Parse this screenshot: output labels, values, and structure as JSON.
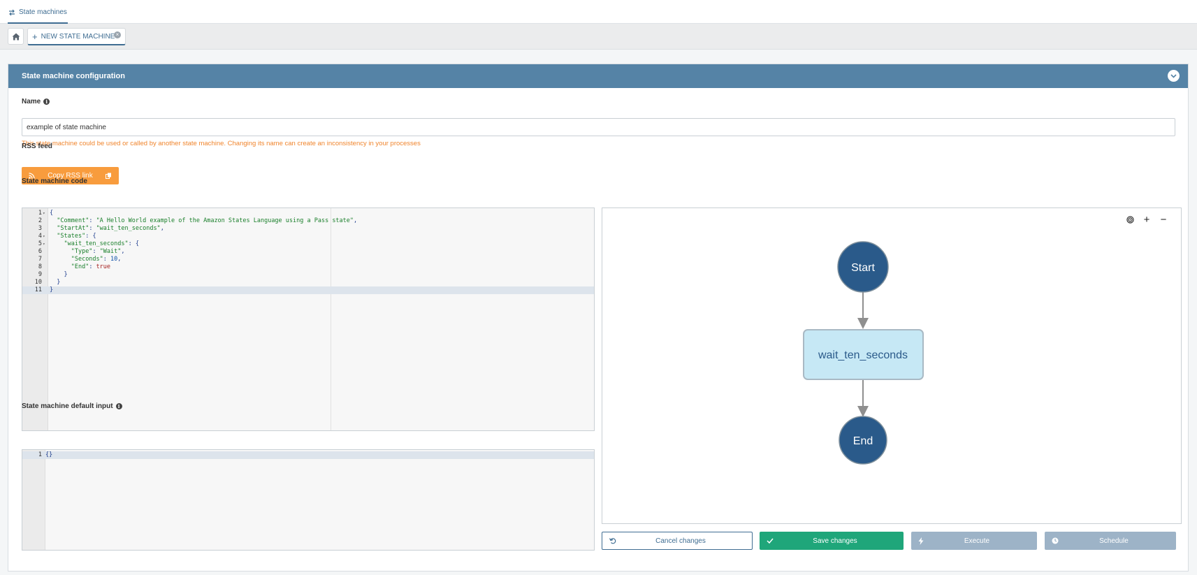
{
  "breadcrumb": {
    "label": "State machines"
  },
  "tabs": {
    "new_tab_label": "NEW STATE MACHINE"
  },
  "panel": {
    "title": "State machine configuration"
  },
  "name_field": {
    "label": "Name",
    "value": "example of state machine",
    "warning": "This state machine could be used or called by another state machine. Changing its name can create an inconsistency in your processes"
  },
  "rss": {
    "label": "RSS feed",
    "button_label": "Copy RSS link"
  },
  "code": {
    "label": "State machine code",
    "lines": [
      {
        "n": "1",
        "fold": true,
        "parts": [
          [
            "p",
            "{"
          ]
        ]
      },
      {
        "n": "2",
        "parts": [
          [
            "p",
            "  "
          ],
          [
            "s",
            "\"Comment\""
          ],
          [
            "p",
            ": "
          ],
          [
            "s",
            "\"A Hello World example of the Amazon States Language using a Pass state\""
          ],
          [
            "p",
            ","
          ]
        ]
      },
      {
        "n": "3",
        "parts": [
          [
            "p",
            "  "
          ],
          [
            "s",
            "\"StartAt\""
          ],
          [
            "p",
            ": "
          ],
          [
            "s",
            "\"wait_ten_seconds\""
          ],
          [
            "p",
            ","
          ]
        ]
      },
      {
        "n": "4",
        "fold": true,
        "parts": [
          [
            "p",
            "  "
          ],
          [
            "s",
            "\"States\""
          ],
          [
            "p",
            ": {"
          ]
        ]
      },
      {
        "n": "5",
        "fold": true,
        "parts": [
          [
            "p",
            "    "
          ],
          [
            "s",
            "\"wait_ten_seconds\""
          ],
          [
            "p",
            ": {"
          ]
        ]
      },
      {
        "n": "6",
        "parts": [
          [
            "p",
            "      "
          ],
          [
            "s",
            "\"Type\""
          ],
          [
            "p",
            ": "
          ],
          [
            "s",
            "\"Wait\""
          ],
          [
            "p",
            ","
          ]
        ]
      },
      {
        "n": "7",
        "parts": [
          [
            "p",
            "      "
          ],
          [
            "s",
            "\"Seconds\""
          ],
          [
            "p",
            ": "
          ],
          [
            "n",
            "10"
          ],
          [
            "p",
            ","
          ]
        ]
      },
      {
        "n": "8",
        "parts": [
          [
            "p",
            "      "
          ],
          [
            "s",
            "\"End\""
          ],
          [
            "p",
            ": "
          ],
          [
            "b",
            "true"
          ]
        ]
      },
      {
        "n": "9",
        "parts": [
          [
            "p",
            "    }"
          ]
        ]
      },
      {
        "n": "10",
        "parts": [
          [
            "p",
            "  }"
          ]
        ]
      },
      {
        "n": "11",
        "active": true,
        "parts": [
          [
            "p",
            "}"
          ]
        ]
      }
    ]
  },
  "default_input": {
    "label": "State machine default input",
    "lines": [
      {
        "n": "1",
        "active": true,
        "parts": [
          [
            "p",
            "{}"
          ]
        ]
      }
    ]
  },
  "graph": {
    "start_label": "Start",
    "state_label": "wait_ten_seconds",
    "end_label": "End",
    "colors": {
      "terminal": "#2a5a8a",
      "state_fill": "#c6e8f5",
      "state_border": "#a9b9c4",
      "edge": "#8f8f8f"
    }
  },
  "actions": {
    "cancel": "Cancel changes",
    "save": "Save changes",
    "execute": "Execute",
    "schedule": "Schedule"
  },
  "icons": [
    "swap-icon",
    "home-icon",
    "plus-icon",
    "close-icon",
    "chevron-down-icon",
    "info-icon",
    "rss-icon",
    "copy-icon",
    "target-icon",
    "zoom-in-icon",
    "zoom-out-icon",
    "undo-icon",
    "check-icon",
    "bolt-icon",
    "clock-icon"
  ]
}
